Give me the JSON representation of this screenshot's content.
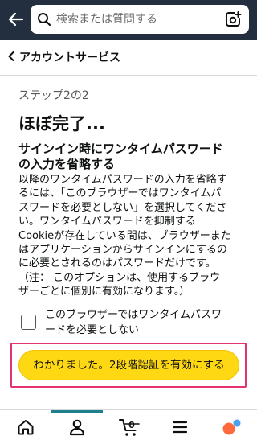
{
  "header": {
    "search_placeholder": "検索または質問する"
  },
  "breadcrumb": {
    "label": "アカウントサービス"
  },
  "main": {
    "step": "ステップ2の2",
    "title": "ほぼ完了...",
    "section_title_lines": [
      "サインイン時にワンタイムパスワード",
      "の入力を省略する"
    ],
    "body_lines": [
      "以降のワンタイムパスワードの入力を省略す",
      "るには、「このブラウザーではワンタイムパ",
      "スワードを必要としない」を選択してくださ",
      "い。ワンタイムパスワードを抑制する",
      "Cookieが存在している間は、ブラウザーまた",
      "はアプリケーションからサインインにするの",
      "に必要とされるのはパスワードだけです。",
      "（注： このオプションは、使用するブラウ",
      "ザーごとに個別に有効になります。）"
    ],
    "checkbox_label_lines": [
      "このブラウザーではワンタイムパスワ",
      "ードを必要としない"
    ],
    "checkbox_checked": false,
    "primary_button": "わかりました。2段階認証を有効にする"
  },
  "bottom_nav": {
    "cart_count": "0",
    "active_item": "account"
  },
  "colors": {
    "header_bg": "#232f3e",
    "button_yellow": "#ffd814",
    "highlight_frame": "#e3346e",
    "active_tab": "#1e7f8e"
  },
  "icons": [
    "back-arrow-icon",
    "search-icon",
    "camera-icon",
    "chevron-left-icon",
    "home-icon",
    "account-icon",
    "cart-icon",
    "menu-icon",
    "assistant-icon"
  ]
}
